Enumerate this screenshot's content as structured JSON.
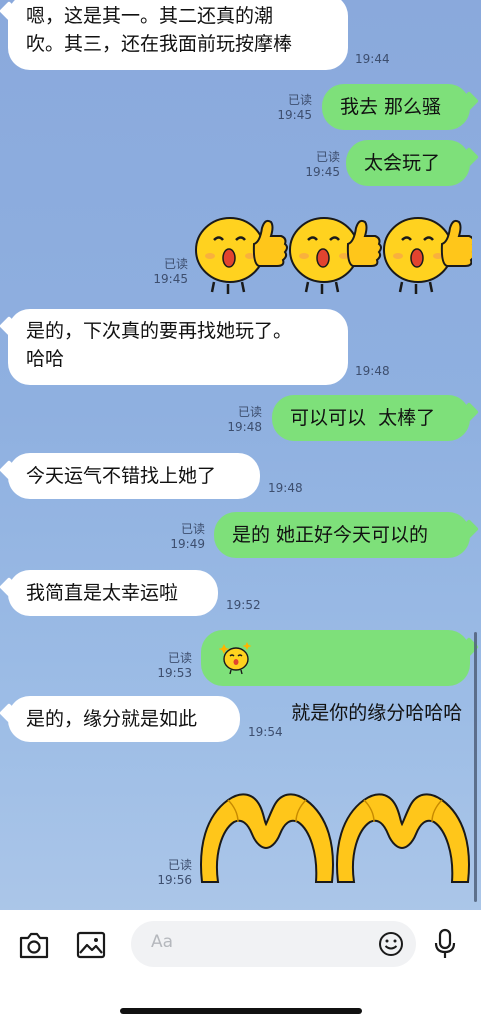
{
  "messages": [
    {
      "dir": "in",
      "text": "嗯，这是其一。其二还真的潮\n吹。其三，还在我面前玩按摩棒",
      "time": "19:44"
    },
    {
      "dir": "out",
      "text": "我去 那么骚",
      "read": "已读",
      "time": "19:45"
    },
    {
      "dir": "out",
      "text": "太会玩了",
      "read": "已读",
      "time": "19:45"
    },
    {
      "dir": "out",
      "type": "sticker",
      "sticker": "chick-thumbs-up-sticker x3",
      "read": "已读",
      "time": "19:45"
    },
    {
      "dir": "in",
      "text": "是的，下次真的要再找她玩了。\n哈哈",
      "time": "19:48"
    },
    {
      "dir": "out",
      "text": "可以可以  太棒了",
      "read": "已读",
      "time": "19:48"
    },
    {
      "dir": "in",
      "text": "今天运气不错找上她了",
      "time": "19:48"
    },
    {
      "dir": "out",
      "text": "是的 她正好今天可以的",
      "read": "已读",
      "time": "19:49"
    },
    {
      "dir": "in",
      "text": "我简直是太幸运啦",
      "time": "19:52"
    },
    {
      "dir": "out",
      "text": "就是你的缘分哈哈哈",
      "emoji": "chick-sparkle-emoji",
      "read": "已读",
      "time": "19:53"
    },
    {
      "dir": "in",
      "text": "是的，缘分就是如此",
      "time": "19:54"
    },
    {
      "dir": "out",
      "type": "sticker",
      "sticker": "heart-hands-sticker x2",
      "read": "已读",
      "time": "19:56"
    }
  ],
  "toolbar": {
    "camera_icon": "camera-icon",
    "gallery_icon": "image-icon",
    "input_placeholder": "Aa",
    "emoji_icon": "smiley-icon",
    "mic_icon": "microphone-icon"
  },
  "colors": {
    "outgoing_bubble": "#7ee07a",
    "incoming_bubble": "#ffffff",
    "background": "#8fb0e0"
  }
}
